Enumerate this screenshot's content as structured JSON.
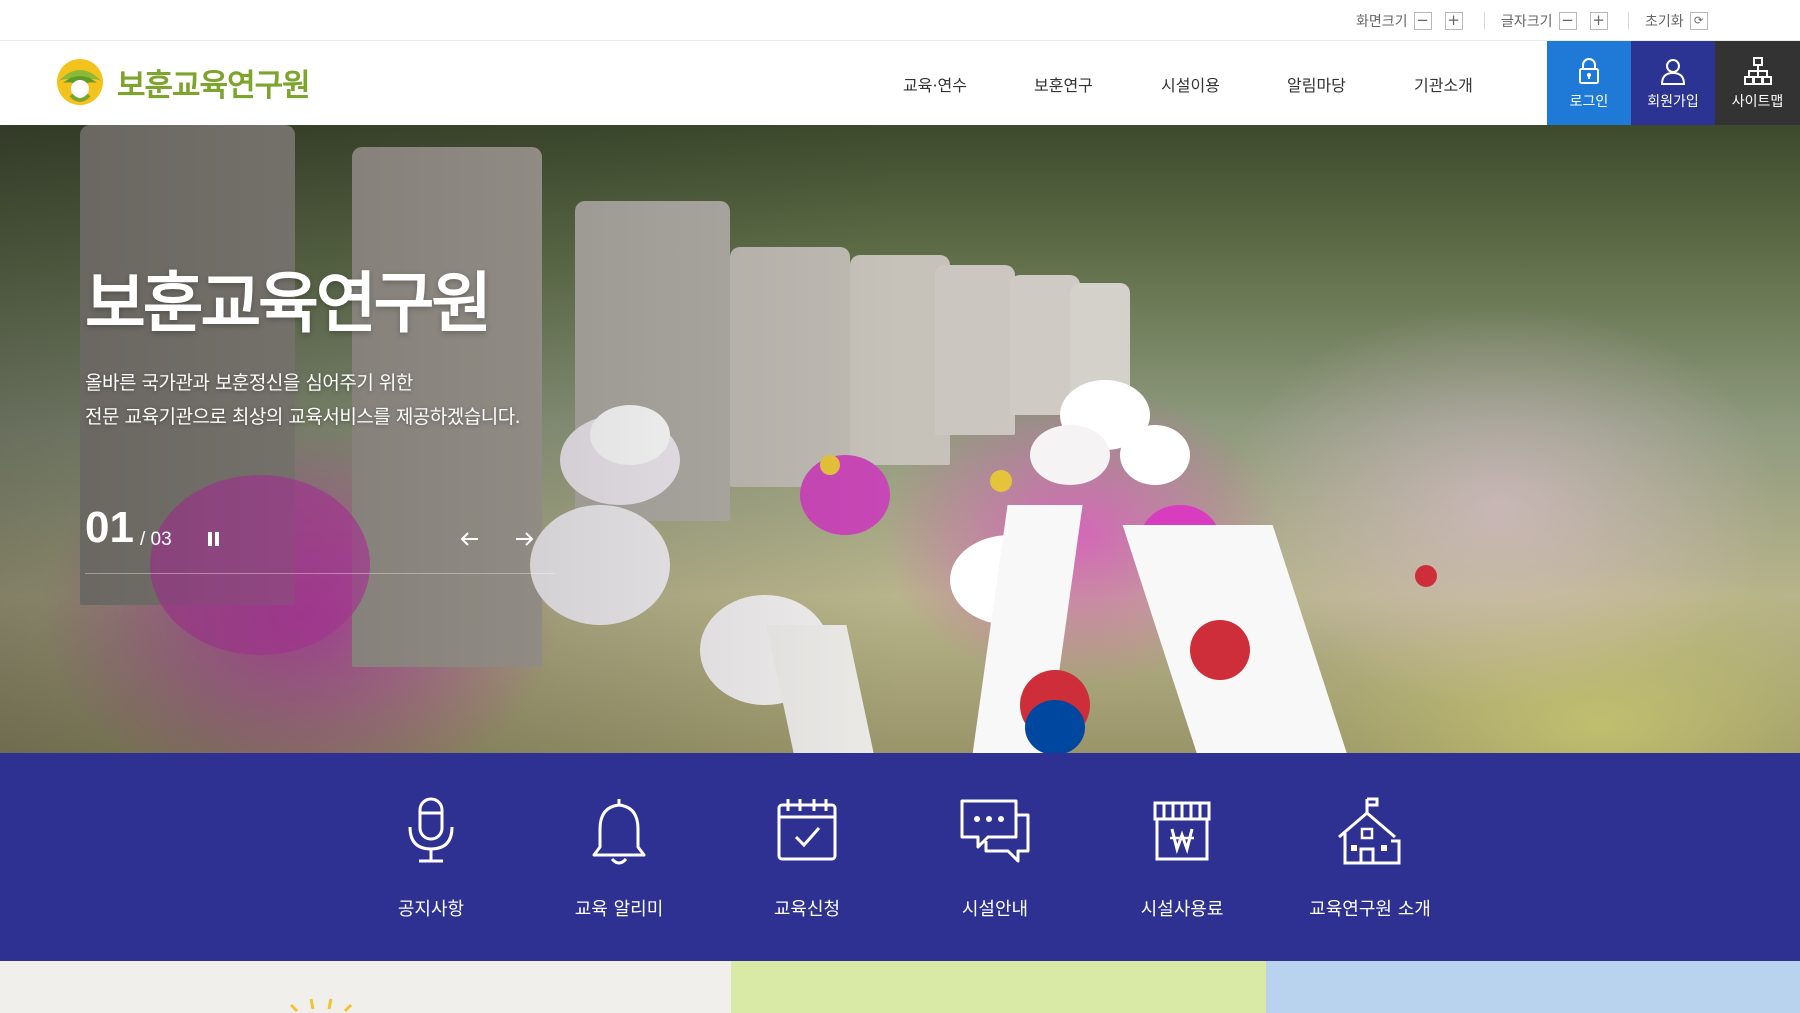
{
  "util": {
    "screen_size_label": "화면크기",
    "font_size_label": "글자크기",
    "reset_label": "초기화",
    "minus": "−",
    "plus": "+"
  },
  "header": {
    "logo_text": "보훈교육연구원",
    "nav": [
      "교육·연수",
      "보훈연구",
      "시설이용",
      "알림마당",
      "기관소개"
    ],
    "buttons": {
      "login": "로그인",
      "signup": "회원가입",
      "sitemap": "사이트맵"
    }
  },
  "hero": {
    "title": "보훈교육연구원",
    "subtitle_line1": "올바른 국가관과 보훈정신을 심어주기 위한",
    "subtitle_line2": "전문 교육기관으로 최상의 교육서비스를 제공하겠습니다.",
    "current_slide": "01",
    "total_slides": "/ 03"
  },
  "quick_menu": [
    {
      "label": "공지사항",
      "icon": "microphone-icon"
    },
    {
      "label": "교육 알리미",
      "icon": "bell-icon"
    },
    {
      "label": "교육신청",
      "icon": "calendar-check-icon"
    },
    {
      "label": "시설안내",
      "icon": "chat-bubbles-icon"
    },
    {
      "label": "시설사용료",
      "icon": "store-won-icon"
    },
    {
      "label": "교육연구원 소개",
      "icon": "school-building-icon"
    }
  ],
  "colors": {
    "brand_green": "#7da42d",
    "login_blue": "#1e7ad6",
    "signup_navy": "#2b3492",
    "sitemap_dark": "#333333",
    "quick_bg": "#2e3192",
    "banner_1": "#f1efec",
    "banner_2": "#d8eaa5",
    "banner_3": "#b9d3ef"
  }
}
